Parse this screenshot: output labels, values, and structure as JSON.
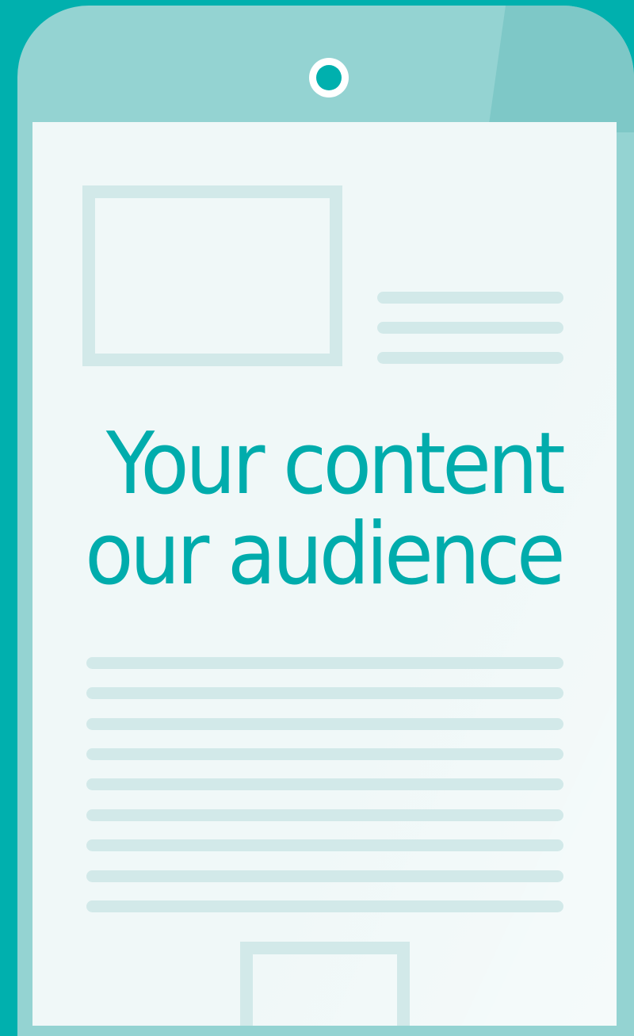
{
  "headline": {
    "line1": "Your content",
    "line2": "our audience"
  },
  "colors": {
    "background": "#00b0ae",
    "phone_body": "#94d3d2",
    "screen": "#f0f8f8",
    "placeholder": "#d2e9e9",
    "accent_text": "#00acac"
  }
}
